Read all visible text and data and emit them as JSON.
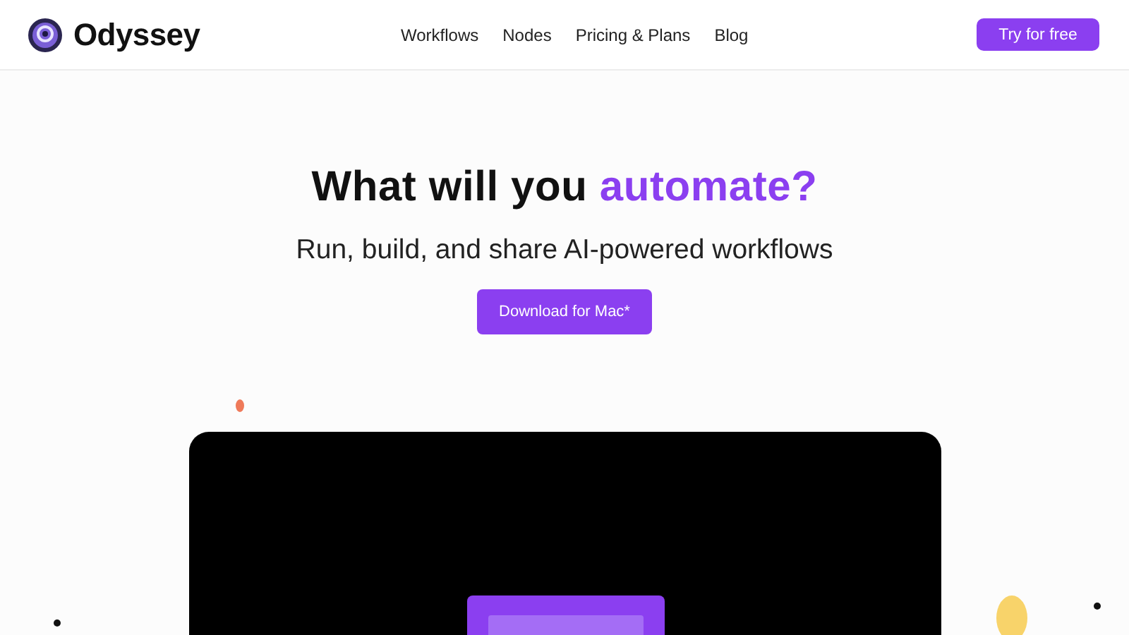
{
  "header": {
    "brand": "Odyssey",
    "nav": [
      "Workflows",
      "Nodes",
      "Pricing & Plans",
      "Blog"
    ],
    "cta": "Try for free"
  },
  "hero": {
    "title_start": "What will you ",
    "title_highlight": "automate?",
    "subtitle": "Run, build, and share AI-powered workflows",
    "button": "Download for Mac*"
  }
}
